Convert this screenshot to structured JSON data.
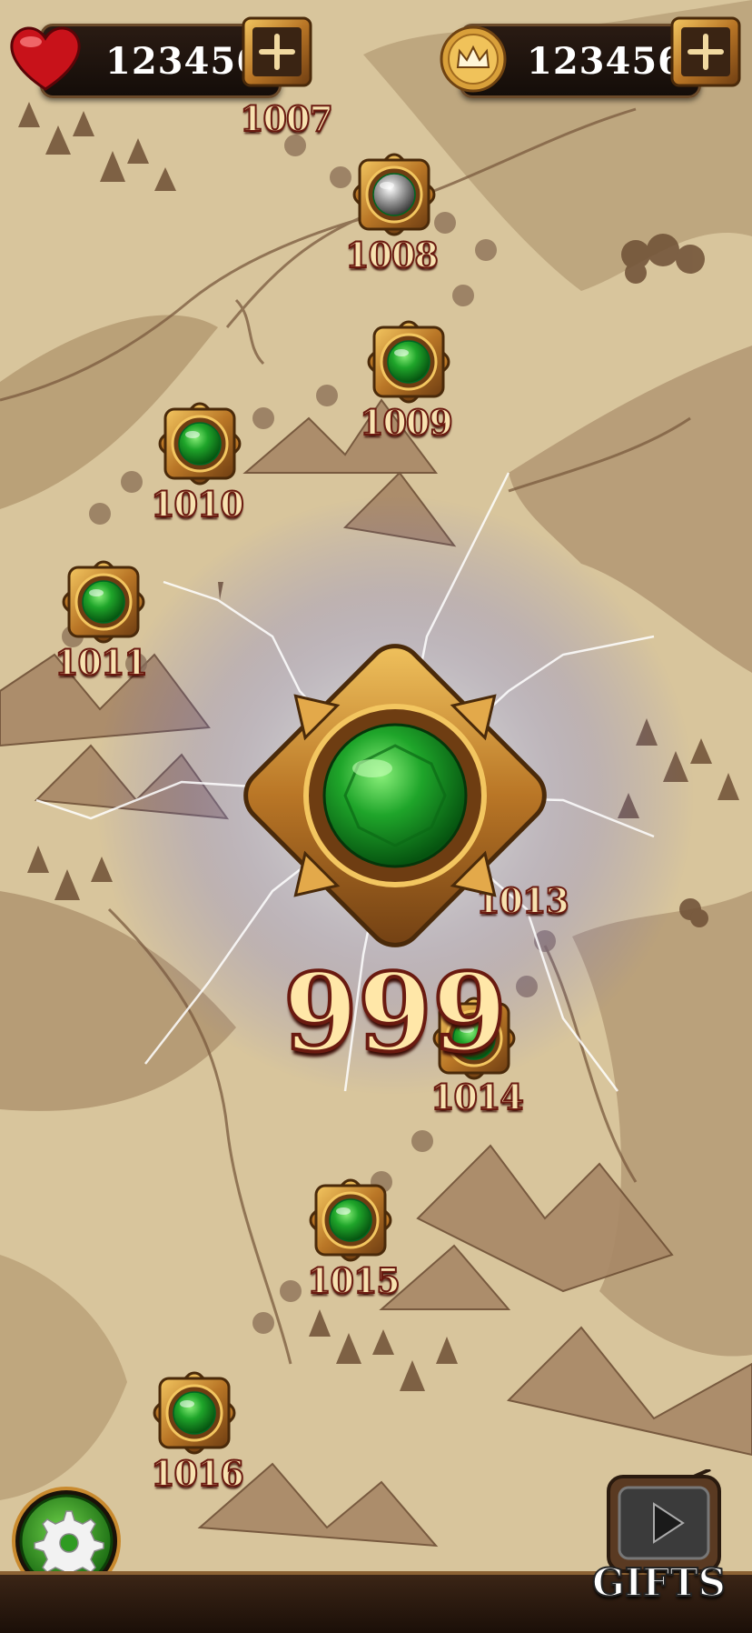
{
  "hud": {
    "lives": {
      "value": "123456",
      "icon": "heart-gem-icon",
      "color": "#c8121a"
    },
    "crowns": {
      "value": "123456",
      "icon": "crown-coin-icon",
      "color": "#d9a03a"
    }
  },
  "levels": [
    {
      "number": "1007",
      "gem": "none"
    },
    {
      "number": "1008",
      "gem": "silver"
    },
    {
      "number": "1009",
      "gem": "green"
    },
    {
      "number": "1010",
      "gem": "green"
    },
    {
      "number": "1011",
      "gem": "green"
    },
    {
      "number": "1013",
      "gem": "green"
    },
    {
      "number": "1014",
      "gem": "green"
    },
    {
      "number": "1015",
      "gem": "green"
    },
    {
      "number": "1016",
      "gem": "green"
    }
  ],
  "current_level": {
    "label": "999",
    "gem": "green",
    "effect": "lightning"
  },
  "gifts_button": {
    "label": "GIFTS",
    "icon": "play-tv-icon"
  },
  "settings_button": {
    "icon": "gear-icon",
    "color": "#2f9b22"
  },
  "colors": {
    "parchment": "#d6c39a",
    "ink": "#7a5a3e",
    "gold": "#c98a2e",
    "gem_green": "#1f9a2a",
    "label_outline": "#6a1a10"
  }
}
